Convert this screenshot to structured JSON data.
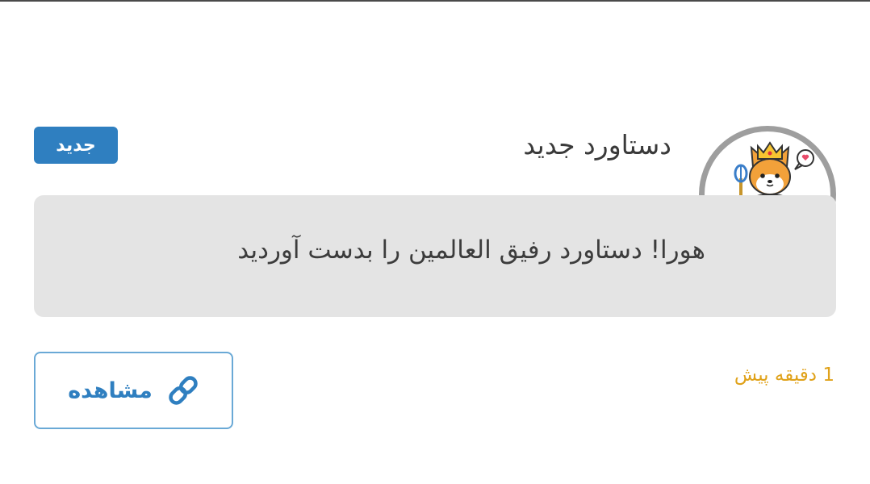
{
  "notification": {
    "title": "دستاورد جدید",
    "badge": "جدید",
    "message": "هورا! دستاورد رفیق العالمین را بدست آوردید",
    "time": "1 دقیقه پیش",
    "view_label": "مشاهده",
    "avatar_icon": "king-fox-icon",
    "link_icon": "link-icon"
  },
  "colors": {
    "badge_bg": "#2f7fc0",
    "time": "#e0a21a",
    "message_box_bg": "#e4e4e4",
    "button_border": "#6aa9d6",
    "button_text": "#2f7fc0",
    "avatar_border": "#9e9e9e"
  }
}
